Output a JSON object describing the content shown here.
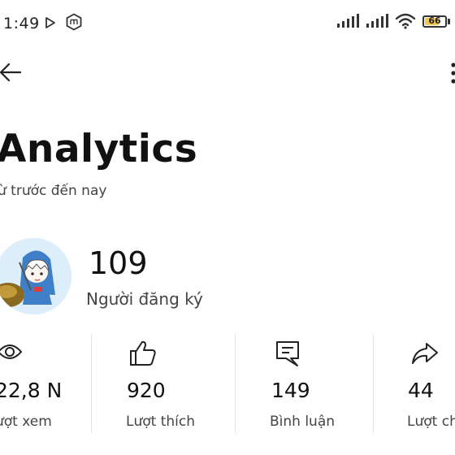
{
  "status_bar": {
    "time": "1:49",
    "battery": "66"
  },
  "header": {
    "title": "Analytics",
    "subtitle": "ừ trước đến nay"
  },
  "channel": {
    "subscribers": "109",
    "subscribers_label": "Người đăng ký"
  },
  "stats": [
    {
      "icon": "eye-icon",
      "value": "22,8 N",
      "label": "ượt xem"
    },
    {
      "icon": "thumbs-up-icon",
      "value": "920",
      "label": "Lượt thích"
    },
    {
      "icon": "comment-icon",
      "value": "149",
      "label": "Bình luận"
    },
    {
      "icon": "share-icon",
      "value": "44",
      "label": "Lượt ch"
    }
  ]
}
